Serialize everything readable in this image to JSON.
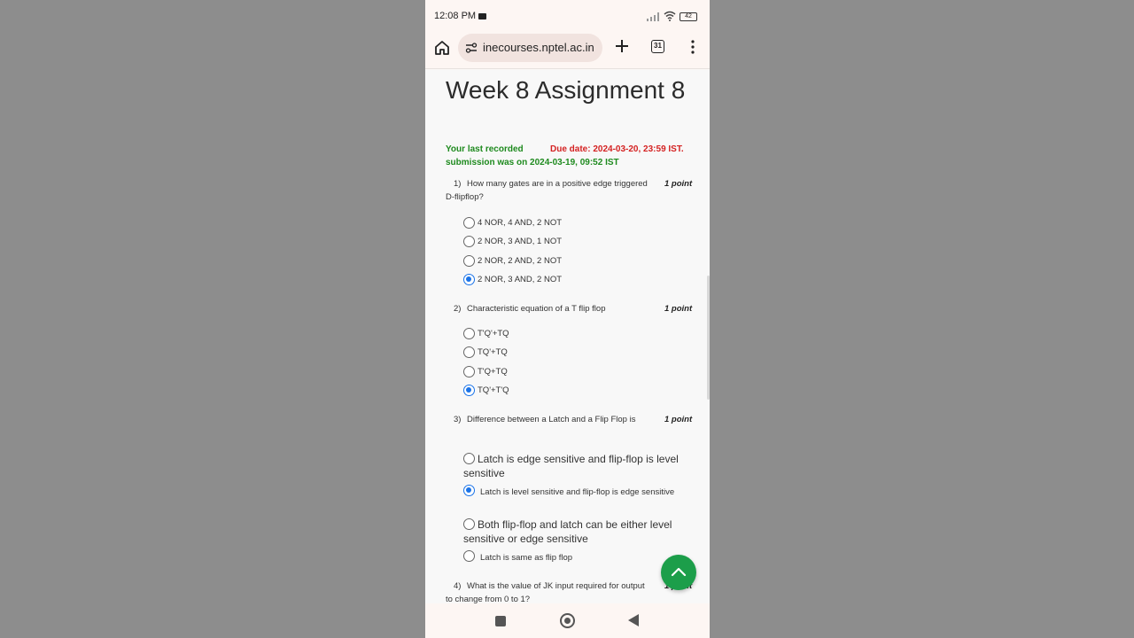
{
  "status_bar": {
    "time": "12:08 PM",
    "battery": "42"
  },
  "browser": {
    "url": "inecourses.nptel.ac.in",
    "tab_count": "31"
  },
  "assignment": {
    "title": "Week 8 Assignment 8",
    "last_submission_line1": "Your last recorded",
    "last_submission_line2": "submission was on 2024-03-19, 09:52 IST",
    "due_date": "Due date: 2024-03-20, 23:59 IST."
  },
  "questions": [
    {
      "number": "1)",
      "text_line1": "How many gates are in a positive edge triggered",
      "text_line2": "D-flipflop?",
      "points": "1 point",
      "options": [
        "4 NOR, 4 AND, 2 NOT",
        "2 NOR, 3 AND, 1 NOT",
        "2 NOR, 2 AND, 2 NOT",
        "2 NOR, 3 AND, 2 NOT"
      ],
      "selected": 3
    },
    {
      "number": "2)",
      "text_line1": "Characteristic equation of a T flip flop",
      "points": "1 point",
      "options": [
        "T'Q'+TQ",
        "TQ'+TQ",
        "T'Q+TQ",
        "TQ'+T'Q"
      ],
      "selected": 3
    },
    {
      "number": "3)",
      "text_line1": "Difference between a Latch and a Flip Flop is",
      "points": "1 point",
      "options": [
        "Latch is edge sensitive and flip-flop is level sensitive",
        "Latch is level sensitive and flip-flop is edge sensitive",
        "Both flip-flop and latch can be either level sensitive or edge sensitive",
        "Latch is same as flip flop"
      ],
      "selected": 1
    },
    {
      "number": "4)",
      "text_line1": "What is the value of JK input required for output",
      "text_line2": "to change from 0 to 1?",
      "points": "1 point"
    }
  ]
}
